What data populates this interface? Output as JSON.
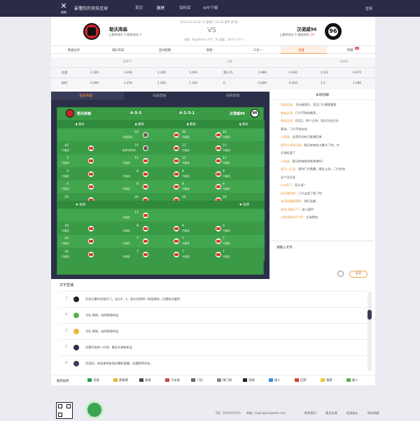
{
  "topnav": {
    "slogan": "最懂你的竞技足球",
    "nav": [
      "首页",
      "比分",
      "资料库",
      "APP下载"
    ],
    "login": "登录",
    "logo": "球吧"
  },
  "match": {
    "home": {
      "name": "勒沃库森",
      "rank_label": "上赛季排名",
      "rank": "4",
      "tag_label": "赛前排名",
      "tag": "9"
    },
    "away": {
      "name": "汉诺威96",
      "rank_label": "上赛季排名",
      "rank": "6",
      "tag_label": "赛前排名",
      "tag": "16"
    },
    "vs": "VS",
    "time": "2016-10-16 04:15  星期六 16-19 德甲 第7轮",
    "venue": "场地：BayArena  天气：阴  温度：28℃~37℃"
  },
  "tabs": [
    {
      "label": "数据分析"
    },
    {
      "label": "球队阵容"
    },
    {
      "label": "亚洲指数"
    },
    {
      "label": "欧赔"
    },
    {
      "label": "三合一"
    },
    {
      "label": "直播"
    },
    {
      "label": "情报",
      "badge": "22"
    }
  ],
  "odds": {
    "groups": [
      "赛季平",
      "让球",
      "总进球"
    ],
    "rows": [
      {
        "label": "初盘",
        "vals": [
          "3.300",
          "3.400",
          "2.200",
          "1.040",
          "受0.25",
          "0.880",
          "0.930",
          "2.5/3",
          "0.970"
        ]
      },
      {
        "label": "即时",
        "vals": [
          "2.000",
          "3.250",
          "2.500",
          "1.100",
          "0",
          "0.800",
          "0.920",
          "1.5",
          "1.080"
        ]
      }
    ]
  },
  "left": {
    "tabs": [
      "首发阵容",
      "动画直播",
      "视频直播"
    ],
    "home": "勒沃库森",
    "home_form": "4-3-3",
    "away_form": "4-2-3-1",
    "away": "汉诺威96",
    "cols": {
      "sub": "替补",
      "coach": "教练"
    },
    "home_coach": "保罗",
    "away_coach": "丹尼尔",
    "rows": [
      {
        "hn": "",
        "hp": "",
        "hcn": "42",
        "hc": "马塞诺克",
        "an": "42",
        "ap": "马塞诺"
      },
      {
        "hn": "42",
        "hp": "马塞诺",
        "hcn": "21",
        "hc": "彼得·斯托利",
        "an": "21",
        "ap": "马塞诺"
      },
      {
        "hn": "2",
        "hp": "马塞诺",
        "hcn": "11",
        "hc": "马塞诺",
        "an": "11",
        "ap": "马塞诺"
      },
      {
        "hn": "3",
        "hp": "马塞诺",
        "hcn": "8",
        "hc": "马塞诺",
        "an": "8",
        "ap": "马塞诺"
      },
      {
        "hn": "4",
        "hp": "马塞诺",
        "hcn": "8",
        "hc": "马塞诺",
        "an": "8",
        "ap": "马塞诺"
      },
      {
        "hn": "20",
        "hp": "马塞诺",
        "hcn": "20",
        "hc": "马塞诺",
        "an": "20",
        "ap": "马塞诺"
      }
    ],
    "cols2": {
      "sub": "伤停",
      "coach": "伤停"
    },
    "rows2": [
      {
        "hn": "",
        "hp": "",
        "hcn": "11",
        "hc": "马塞诺",
        "an": "",
        "ap": ""
      },
      {
        "hn": "20",
        "hp": "马塞诺",
        "hcn": "9",
        "hc": "马塞诺",
        "an": "9",
        "ap": "马塞诺"
      },
      {
        "hn": "20",
        "hp": "马塞诺",
        "hcn": "7",
        "hc": "马塞诺",
        "an": "7",
        "ap": "马塞诺"
      },
      {
        "hn": "20",
        "hp": "马塞诺",
        "hcn": "7",
        "hc": "马塞诺",
        "an": "7",
        "ap": "马塞诺"
      }
    ]
  },
  "chat": {
    "title": "本场热聊",
    "messages": [
      {
        "u": "铁血足球：",
        "t": "主队越强大，而且门兴遭遇重挫"
      },
      {
        "u": "铁血足球：",
        "t": "门兴不败的概率，"
      },
      {
        "u": "铁血足球：",
        "t": "6月后，两个主场，再次开启主场"
      },
      {
        "u": "",
        "t": "客场，门兴不排名地"
      },
      {
        "u": "小球迷：",
        "t": "这家伙也有可能拿回来"
      },
      {
        "u": "德甲水深似坑球：",
        "t": "勒沃库森也太暴力了吧，作"
      },
      {
        "u": "",
        "t": "大球机要了"
      },
      {
        "u": "小球迷：",
        "t": "勒沃库森依然有希望吗？"
      },
      {
        "u": "勒沃一日游：",
        "t": "预测门兴勒赢，最佳上攻，门兴进攻"
      },
      {
        "u": "",
        "t": "半个月后说"
      },
      {
        "u": "jing921：",
        "t": "怎么说？"
      },
      {
        "u": "好好睡觉吧：",
        "t": "门兴这里了呢了吧"
      },
      {
        "u": "本家收藏德国球：",
        "t": "我们无解"
      },
      {
        "u": "爱球 球球177：",
        "t": "进入德甲"
      },
      {
        "u": "点赞调球的2个吧：",
        "t": "主场得势"
      }
    ],
    "placeholder": "请输入文字...",
    "send": "发表"
  },
  "live": {
    "title": "文字直播",
    "rows": [
      {
        "t": "7'",
        "tx": "开局马塞尔伦敦打门，比分1：1，双方仍然同一阶段相持，比赛有点激烈"
      },
      {
        "t": "4'",
        "tx": "主队 角球，连续角球机会"
      },
      {
        "t": "2'",
        "tx": "主队 角球，连续角球机会"
      },
      {
        "t": "1'",
        "tx": "比赛开始的一分钟，客队头球有机会"
      },
      {
        "t": "0'",
        "tx": "大家好，欢迎来到本场比赛的直播，比赛即将开始..."
      }
    ]
  },
  "legend": {
    "label": "图例说明",
    "items": [
      "点球",
      "两黄牌",
      "角球",
      "乌龙球",
      "门柱",
      "球门球",
      "进球",
      "换人",
      "红牌",
      "黄牌",
      "换人"
    ]
  },
  "footer": {
    "qq": "QQ：1024521245",
    "email": "邮箱：zuqiu@vixisports.com",
    "links": [
      "联系我们",
      "意见反馈",
      "招贤纳士",
      "网站地图"
    ]
  }
}
